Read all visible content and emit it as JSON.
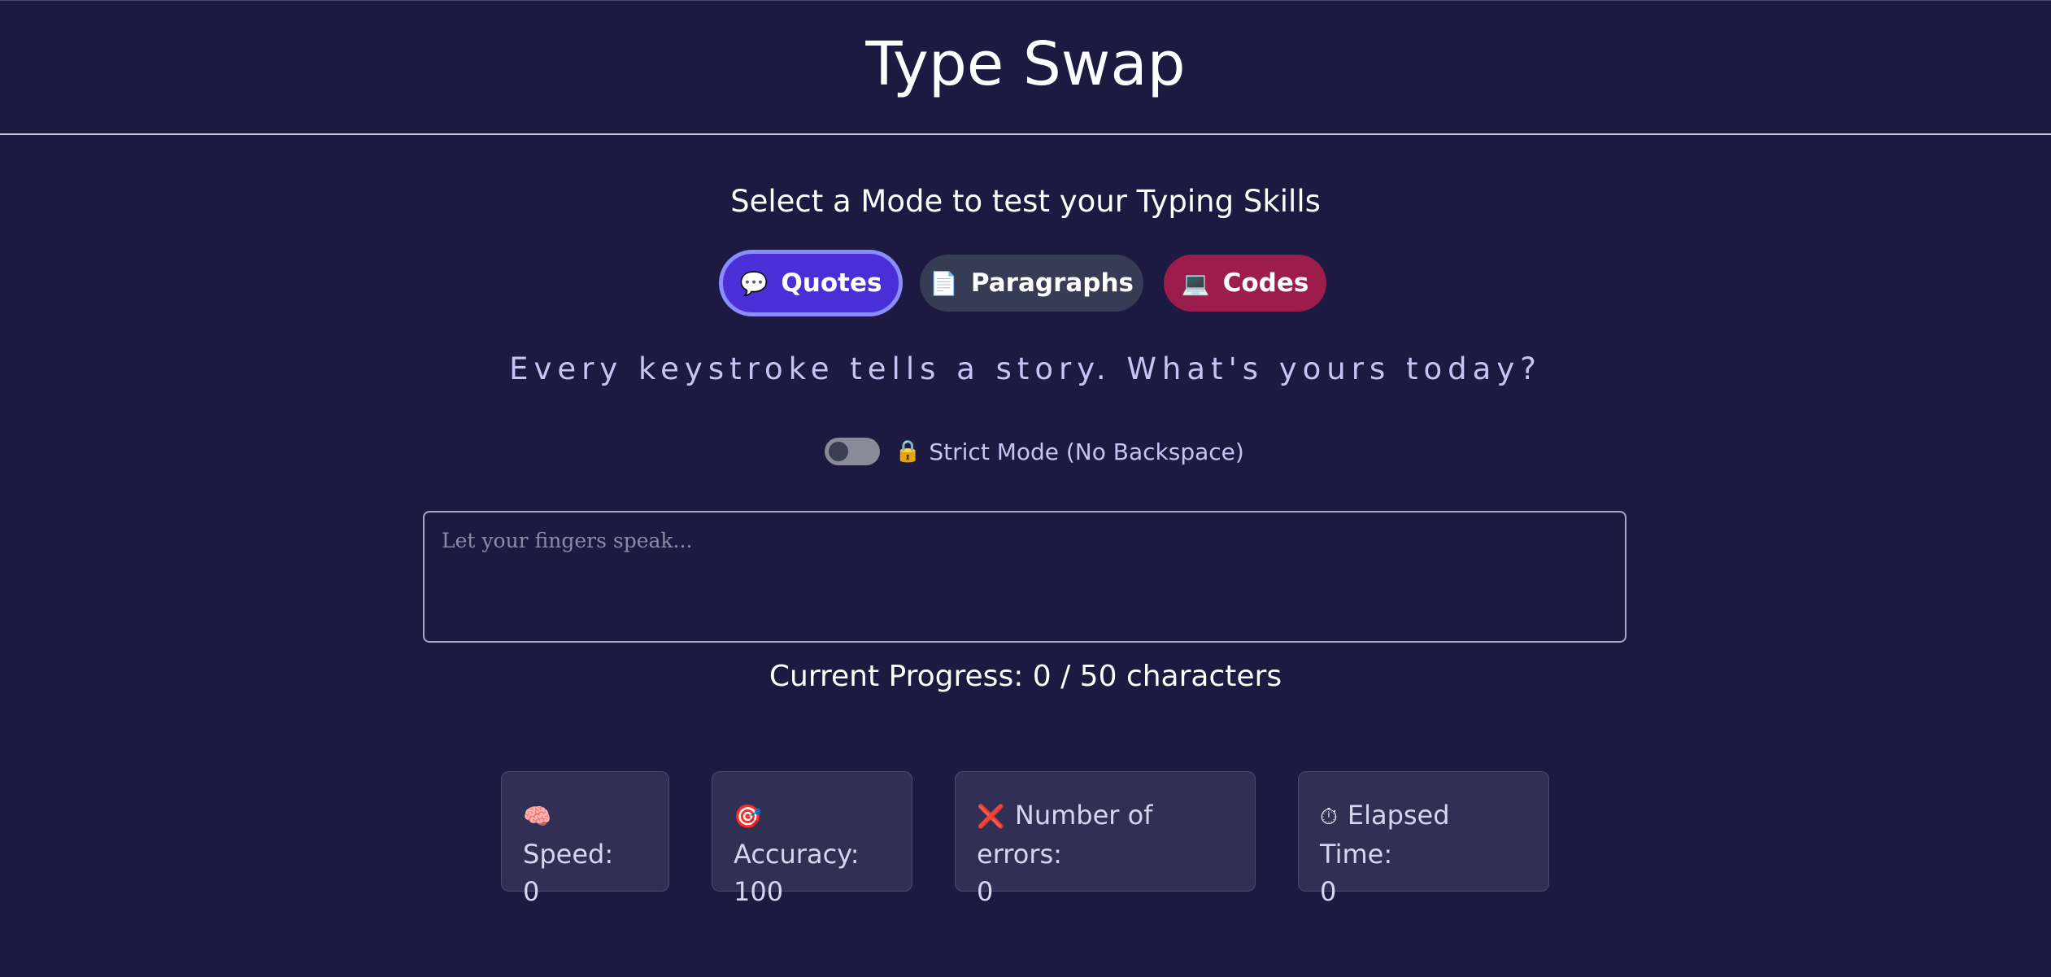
{
  "app": {
    "title": "Type Swap"
  },
  "mode_selector": {
    "prompt": "Select a Mode to test your Typing Skills",
    "modes": [
      {
        "label": "Quotes",
        "icon": "speech-bubble-icon",
        "color": "#4a2fd6",
        "selected": true
      },
      {
        "label": "Paragraphs",
        "icon": "document-icon",
        "color": "#353c53",
        "selected": false
      },
      {
        "label": "Codes",
        "icon": "laptop-icon",
        "color": "#9c1d4c",
        "selected": false
      }
    ]
  },
  "tagline": "Every keystroke tells a story. What's yours today?",
  "strict_mode": {
    "label": "Strict Mode (No Backspace)",
    "icon": "lock-icon",
    "enabled": false
  },
  "typing_area": {
    "placeholder": "Let your fingers speak...",
    "value": ""
  },
  "progress": {
    "text": "Current Progress: 0 / 50 characters",
    "current": 0,
    "total": 50
  },
  "stats": [
    {
      "label": "Speed:",
      "value": "0",
      "icon": "brain-icon"
    },
    {
      "label": "Accuracy:",
      "value": "100",
      "icon": "target-icon"
    },
    {
      "label": "Number of errors:",
      "value": "0",
      "icon": "cross-icon"
    },
    {
      "label": "Elapsed Time:",
      "value": "0",
      "icon": "stopwatch-icon"
    }
  ],
  "colors": {
    "background": "#1c1a40",
    "accent": "#4a2fd6",
    "tagline": "#c6c4f4",
    "card": "#322f54"
  }
}
